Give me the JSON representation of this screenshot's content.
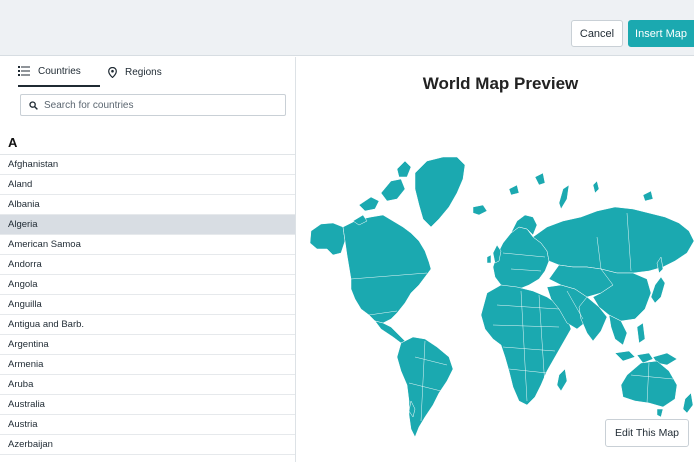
{
  "toolbar": {
    "cancel_label": "Cancel",
    "insert_label": "Insert Map"
  },
  "sidebar": {
    "tabs": [
      {
        "label": "Countries",
        "icon": "list-icon",
        "active": true
      },
      {
        "label": "Regions",
        "icon": "map-pin-icon",
        "active": false
      }
    ],
    "search": {
      "placeholder": "Search for countries",
      "value": ""
    },
    "section_letter": "A",
    "selected": "Algeria",
    "items": [
      "Afghanistan",
      "Aland",
      "Albania",
      "Algeria",
      "American Samoa",
      "Andorra",
      "Angola",
      "Anguilla",
      "Antigua and Barb.",
      "Argentina",
      "Armenia",
      "Aruba",
      "Australia",
      "Austria",
      "Azerbaijan"
    ]
  },
  "main": {
    "title": "World Map Preview",
    "edit_label": "Edit This Map",
    "map_fill_color": "#1ba9b0",
    "map_border_color": "#ffffff"
  },
  "colors": {
    "accent": "#1ba9b0",
    "selected_row": "#d8dde3",
    "topbar": "#eef1f4"
  }
}
